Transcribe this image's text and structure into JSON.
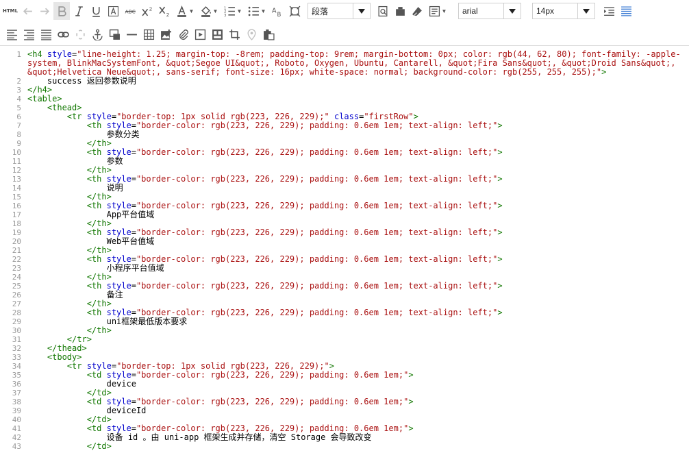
{
  "toolbar": {
    "html_label": "HTML",
    "paragraph_select": "段落",
    "font_select": "arial",
    "size_select": "14px"
  },
  "code": {
    "lines": [
      {
        "n": "1",
        "parts": [
          [
            "tag",
            "<h4 "
          ],
          [
            "attr",
            "style"
          ],
          [
            "text",
            "="
          ],
          [
            "str",
            "\"line-height: 1.25; margin-top: -8rem; padding-top: 9rem; margin-bottom: 0px; color: rgb(44, 62, 80); font-family: -apple-"
          ]
        ]
      },
      {
        "n": "",
        "parts": [
          [
            "str",
            "system, BlinkMacSystemFont, &quot;Segoe UI&quot;, Roboto, Oxygen, Ubuntu, Cantarell, &quot;Fira Sans&quot;, &quot;Droid Sans&quot;,"
          ]
        ]
      },
      {
        "n": "",
        "parts": [
          [
            "str",
            "&quot;Helvetica Neue&quot;, sans-serif; font-size: 16px; white-space: normal; background-color: rgb(255, 255, 255);\""
          ],
          [
            "tag",
            ">"
          ]
        ]
      },
      {
        "n": "2",
        "parts": [
          [
            "text",
            "    success 返回参数说明"
          ]
        ]
      },
      {
        "n": "3",
        "parts": [
          [
            "tag",
            "</h4>"
          ]
        ]
      },
      {
        "n": "4",
        "parts": [
          [
            "tag",
            "<table>"
          ]
        ]
      },
      {
        "n": "5",
        "parts": [
          [
            "tag",
            "    <thead>"
          ]
        ]
      },
      {
        "n": "6",
        "parts": [
          [
            "tag",
            "        <tr "
          ],
          [
            "attr",
            "style"
          ],
          [
            "text",
            "="
          ],
          [
            "str",
            "\"border-top: 1px solid rgb(223, 226, 229);\""
          ],
          [
            "text",
            " "
          ],
          [
            "attr",
            "class"
          ],
          [
            "text",
            "="
          ],
          [
            "str",
            "\"firstRow\""
          ],
          [
            "tag",
            ">"
          ]
        ]
      },
      {
        "n": "7",
        "parts": [
          [
            "tag",
            "            <th "
          ],
          [
            "attr",
            "style"
          ],
          [
            "text",
            "="
          ],
          [
            "str",
            "\"border-color: rgb(223, 226, 229); padding: 0.6em 1em; text-align: left;\""
          ],
          [
            "tag",
            ">"
          ]
        ]
      },
      {
        "n": "8",
        "parts": [
          [
            "text",
            "                参数分类"
          ]
        ]
      },
      {
        "n": "9",
        "parts": [
          [
            "tag",
            "            </th>"
          ]
        ]
      },
      {
        "n": "10",
        "parts": [
          [
            "tag",
            "            <th "
          ],
          [
            "attr",
            "style"
          ],
          [
            "text",
            "="
          ],
          [
            "str",
            "\"border-color: rgb(223, 226, 229); padding: 0.6em 1em; text-align: left;\""
          ],
          [
            "tag",
            ">"
          ]
        ]
      },
      {
        "n": "11",
        "parts": [
          [
            "text",
            "                参数"
          ]
        ]
      },
      {
        "n": "12",
        "parts": [
          [
            "tag",
            "            </th>"
          ]
        ]
      },
      {
        "n": "13",
        "parts": [
          [
            "tag",
            "            <th "
          ],
          [
            "attr",
            "style"
          ],
          [
            "text",
            "="
          ],
          [
            "str",
            "\"border-color: rgb(223, 226, 229); padding: 0.6em 1em; text-align: left;\""
          ],
          [
            "tag",
            ">"
          ]
        ]
      },
      {
        "n": "14",
        "parts": [
          [
            "text",
            "                说明"
          ]
        ]
      },
      {
        "n": "15",
        "parts": [
          [
            "tag",
            "            </th>"
          ]
        ]
      },
      {
        "n": "16",
        "parts": [
          [
            "tag",
            "            <th "
          ],
          [
            "attr",
            "style"
          ],
          [
            "text",
            "="
          ],
          [
            "str",
            "\"border-color: rgb(223, 226, 229); padding: 0.6em 1em; text-align: left;\""
          ],
          [
            "tag",
            ">"
          ]
        ]
      },
      {
        "n": "17",
        "parts": [
          [
            "text",
            "                App平台值域"
          ]
        ]
      },
      {
        "n": "18",
        "parts": [
          [
            "tag",
            "            </th>"
          ]
        ]
      },
      {
        "n": "19",
        "parts": [
          [
            "tag",
            "            <th "
          ],
          [
            "attr",
            "style"
          ],
          [
            "text",
            "="
          ],
          [
            "str",
            "\"border-color: rgb(223, 226, 229); padding: 0.6em 1em; text-align: left;\""
          ],
          [
            "tag",
            ">"
          ]
        ]
      },
      {
        "n": "20",
        "parts": [
          [
            "text",
            "                Web平台值域"
          ]
        ]
      },
      {
        "n": "21",
        "parts": [
          [
            "tag",
            "            </th>"
          ]
        ]
      },
      {
        "n": "22",
        "parts": [
          [
            "tag",
            "            <th "
          ],
          [
            "attr",
            "style"
          ],
          [
            "text",
            "="
          ],
          [
            "str",
            "\"border-color: rgb(223, 226, 229); padding: 0.6em 1em; text-align: left;\""
          ],
          [
            "tag",
            ">"
          ]
        ]
      },
      {
        "n": "23",
        "parts": [
          [
            "text",
            "                小程序平台值域"
          ]
        ]
      },
      {
        "n": "24",
        "parts": [
          [
            "tag",
            "            </th>"
          ]
        ]
      },
      {
        "n": "25",
        "parts": [
          [
            "tag",
            "            <th "
          ],
          [
            "attr",
            "style"
          ],
          [
            "text",
            "="
          ],
          [
            "str",
            "\"border-color: rgb(223, 226, 229); padding: 0.6em 1em; text-align: left;\""
          ],
          [
            "tag",
            ">"
          ]
        ]
      },
      {
        "n": "26",
        "parts": [
          [
            "text",
            "                备注"
          ]
        ]
      },
      {
        "n": "27",
        "parts": [
          [
            "tag",
            "            </th>"
          ]
        ]
      },
      {
        "n": "28",
        "parts": [
          [
            "tag",
            "            <th "
          ],
          [
            "attr",
            "style"
          ],
          [
            "text",
            "="
          ],
          [
            "str",
            "\"border-color: rgb(223, 226, 229); padding: 0.6em 1em; text-align: left;\""
          ],
          [
            "tag",
            ">"
          ]
        ]
      },
      {
        "n": "29",
        "parts": [
          [
            "text",
            "                uni框架最低版本要求"
          ]
        ]
      },
      {
        "n": "30",
        "parts": [
          [
            "tag",
            "            </th>"
          ]
        ]
      },
      {
        "n": "31",
        "parts": [
          [
            "tag",
            "        </tr>"
          ]
        ]
      },
      {
        "n": "32",
        "parts": [
          [
            "tag",
            "    </thead>"
          ]
        ]
      },
      {
        "n": "33",
        "parts": [
          [
            "tag",
            "    <tbody>"
          ]
        ]
      },
      {
        "n": "34",
        "parts": [
          [
            "tag",
            "        <tr "
          ],
          [
            "attr",
            "style"
          ],
          [
            "text",
            "="
          ],
          [
            "str",
            "\"border-top: 1px solid rgb(223, 226, 229);\""
          ],
          [
            "tag",
            ">"
          ]
        ]
      },
      {
        "n": "35",
        "parts": [
          [
            "tag",
            "            <td "
          ],
          [
            "attr",
            "style"
          ],
          [
            "text",
            "="
          ],
          [
            "str",
            "\"border-color: rgb(223, 226, 229); padding: 0.6em 1em;\""
          ],
          [
            "tag",
            ">"
          ]
        ]
      },
      {
        "n": "36",
        "parts": [
          [
            "text",
            "                device"
          ]
        ]
      },
      {
        "n": "37",
        "parts": [
          [
            "tag",
            "            </td>"
          ]
        ]
      },
      {
        "n": "38",
        "parts": [
          [
            "tag",
            "            <td "
          ],
          [
            "attr",
            "style"
          ],
          [
            "text",
            "="
          ],
          [
            "str",
            "\"border-color: rgb(223, 226, 229); padding: 0.6em 1em;\""
          ],
          [
            "tag",
            ">"
          ]
        ]
      },
      {
        "n": "39",
        "parts": [
          [
            "text",
            "                deviceId"
          ]
        ]
      },
      {
        "n": "40",
        "parts": [
          [
            "tag",
            "            </td>"
          ]
        ]
      },
      {
        "n": "41",
        "parts": [
          [
            "tag",
            "            <td "
          ],
          [
            "attr",
            "style"
          ],
          [
            "text",
            "="
          ],
          [
            "str",
            "\"border-color: rgb(223, 226, 229); padding: 0.6em 1em;\""
          ],
          [
            "tag",
            ">"
          ]
        ]
      },
      {
        "n": "42",
        "parts": [
          [
            "text",
            "                设备 id 。由 uni-app 框架生成并存储，清空 Storage 会导致改变"
          ]
        ]
      },
      {
        "n": "43",
        "parts": [
          [
            "tag",
            "            </td>"
          ]
        ]
      }
    ]
  }
}
